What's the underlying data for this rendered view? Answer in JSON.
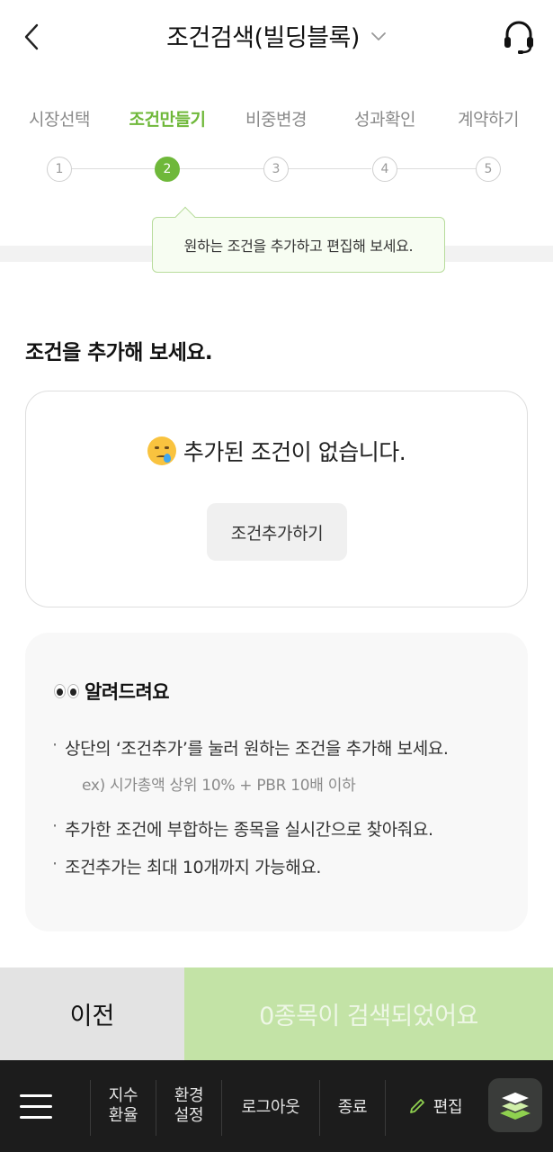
{
  "header": {
    "title": "조건검색(빌딩블록)"
  },
  "steps": [
    {
      "label": "시장선택",
      "num": "1"
    },
    {
      "label": "조건만들기",
      "num": "2"
    },
    {
      "label": "비중변경",
      "num": "3"
    },
    {
      "label": "성과확인",
      "num": "4"
    },
    {
      "label": "계약하기",
      "num": "5"
    }
  ],
  "active_step": 2,
  "tooltip": "원하는 조건을 추가하고 편집해 보세요.",
  "section_title": "조건을 추가해 보세요.",
  "empty": {
    "message": "추가된 조건이 없습니다.",
    "add_button": "조건추가하기"
  },
  "notice": {
    "title": "알려드려요",
    "items": [
      "상단의 ‘조건추가’를 눌러 원하는 조건을 추가해 보세요.",
      "추가한 조건에 부합하는 종목을 실시간으로 찾아줘요.",
      "조건추가는 최대 10개까지 가능해요."
    ],
    "example": "ex) 시가총액 상위 10%  + PBR 10배 이하"
  },
  "actions": {
    "prev": "이전",
    "result": "0종목이 검색되었어요"
  },
  "tabbar": {
    "index_line1": "지수",
    "index_line2": "환율",
    "env_line1": "환경",
    "env_line2": "설정",
    "logout": "로그아웃",
    "exit": "종료",
    "edit": "편집"
  },
  "colors": {
    "accent": "#6fb83a",
    "result_bg": "#c3e3a6",
    "tabbar_bg": "#1c1c1c"
  }
}
